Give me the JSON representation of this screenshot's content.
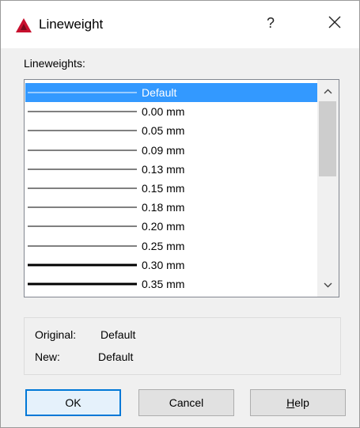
{
  "window": {
    "title": "Lineweight",
    "help_glyph": "?",
    "app_icon": "autocad-logo-icon",
    "accent_color": "#0078d7",
    "selection_color": "#3399ff"
  },
  "list": {
    "label": "Lineweights:",
    "selected_index": 0,
    "items": [
      {
        "label": "Default",
        "thickness": 1
      },
      {
        "label": "0.00 mm",
        "thickness": 1
      },
      {
        "label": "0.05 mm",
        "thickness": 1
      },
      {
        "label": "0.09 mm",
        "thickness": 1
      },
      {
        "label": "0.13 mm",
        "thickness": 1
      },
      {
        "label": "0.15 mm",
        "thickness": 1
      },
      {
        "label": "0.18 mm",
        "thickness": 1
      },
      {
        "label": "0.20 mm",
        "thickness": 1
      },
      {
        "label": "0.25 mm",
        "thickness": 1
      },
      {
        "label": "0.30 mm",
        "thickness": 3
      },
      {
        "label": "0.35 mm",
        "thickness": 3
      }
    ]
  },
  "info": {
    "original_label": "Original:",
    "original_value": "Default",
    "new_label": "New:",
    "new_value": "Default"
  },
  "buttons": {
    "ok": "OK",
    "cancel": "Cancel",
    "help_mnemonic": "H",
    "help_rest": "elp"
  }
}
